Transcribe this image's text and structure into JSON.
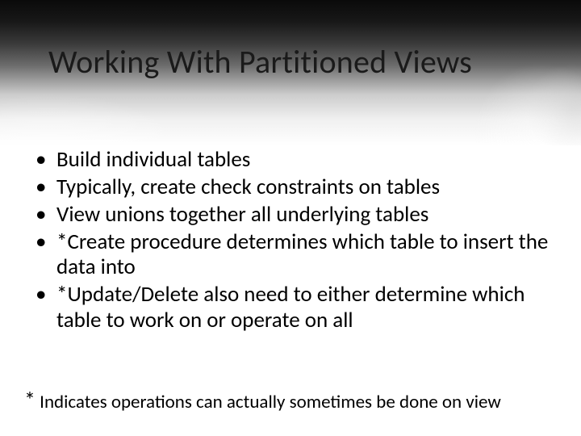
{
  "title": "Working With Partitioned Views",
  "bullets": [
    "Build individual tables",
    "Typically, create check constraints on tables",
    "View unions together all underlying tables",
    "*Create procedure determines which table to insert the data into",
    "*Update/Delete also need to either determine which table to work on or operate on all"
  ],
  "footnote": {
    "marker": "*",
    "text": " Indicates operations can actually sometimes be done on view"
  }
}
